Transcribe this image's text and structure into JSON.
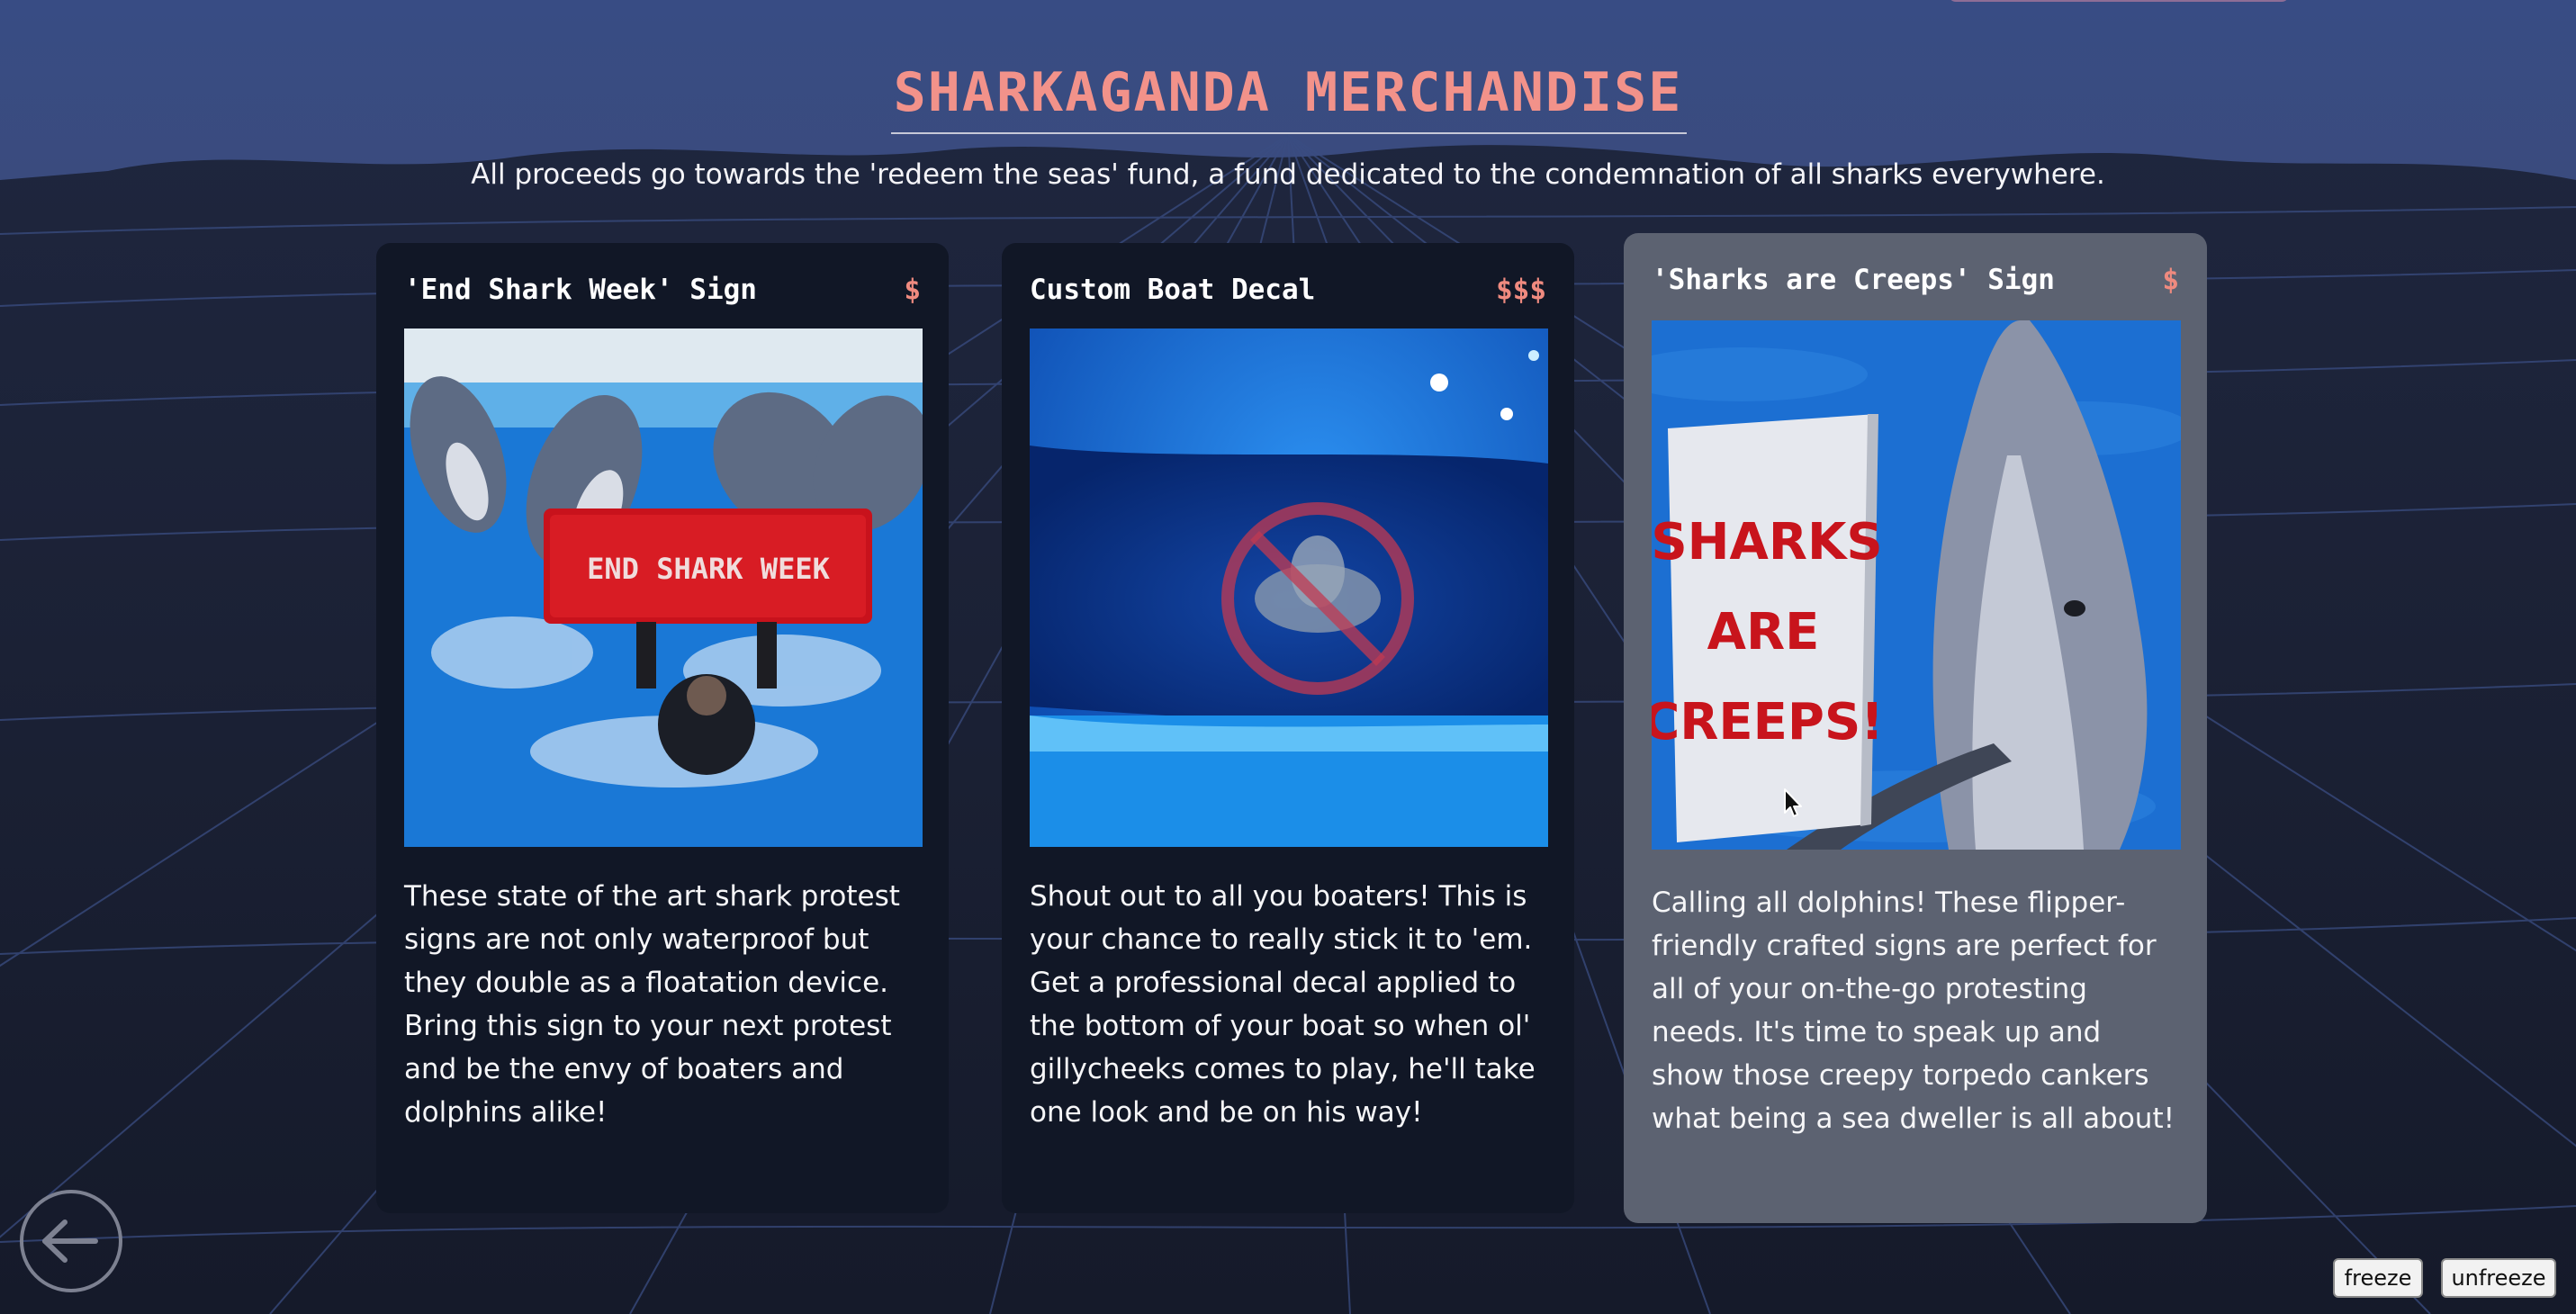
{
  "page": {
    "title": "SHARKAGANDA MERCHANDISE",
    "subtitle": "All proceeds go towards the 'redeem the seas' fund, a fund dedicated to the condemnation of all sharks everywhere."
  },
  "products": [
    {
      "name": "'End Shark Week' Sign",
      "price": "$",
      "image_text": "END SHARK WEEK",
      "description": "These state of the art shark protest signs are not only waterproof but they double as a floatation device. Bring this sign to your next protest and be the envy of boaters and dolphins alike!"
    },
    {
      "name": "Custom Boat Decal",
      "price": "$$$",
      "description": "Shout out to all you boaters! This is your chance to really stick it to 'em. Get a professional decal applied to the bottom of your boat so when ol' gillycheeks comes to play, he'll take one look and be on his way!"
    },
    {
      "name": "'Sharks are Creeps' Sign",
      "price": "$",
      "image_text": [
        "SHARKS",
        "ARE",
        "CREEPS!"
      ],
      "description": "Calling all dolphins! These flipper-friendly crafted signs are perfect for all of your on-the-go protesting needs. It's time to speak up and show those creepy torpedo cankers what being a sea dweller is all about!"
    }
  ],
  "controls": {
    "freeze_label": "freeze",
    "unfreeze_label": "unfreeze",
    "back_icon": "arrow-left-circle-icon"
  },
  "colors": {
    "title": "#f2928a",
    "price": "#ef8a7f",
    "card_bg": "#111726",
    "card_hover_bg": "#5c6271"
  }
}
